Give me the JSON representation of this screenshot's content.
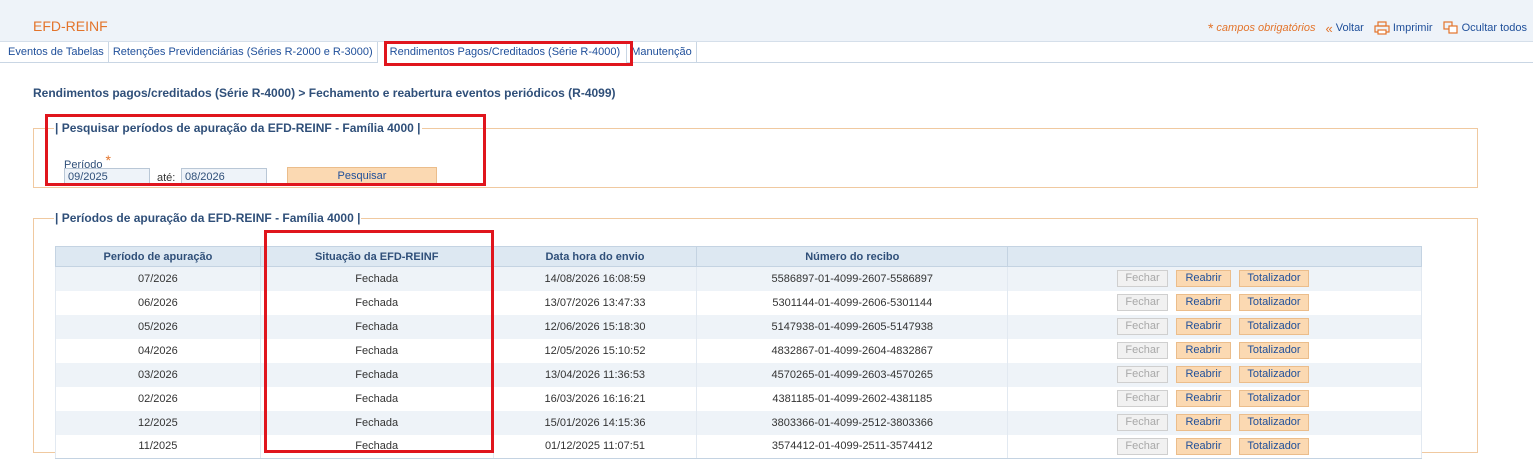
{
  "header": {
    "title": "EFD-REINF",
    "required_note": "campos obrigatórios",
    "back_label": "Voltar",
    "print_label": "Imprimir",
    "hide_all_label": "Ocultar todos"
  },
  "tabs": [
    {
      "label": "Eventos de Tabelas"
    },
    {
      "label": "Retenções Previdenciárias (Séries R-2000 e R-3000)"
    },
    {
      "label": "Rendimentos Pagos/Creditados (Série R-4000)"
    },
    {
      "label": "Manutenção"
    }
  ],
  "breadcrumb": "Rendimentos pagos/creditados (Série R-4000) > Fechamento e reabertura eventos periódicos (R-4099)",
  "search": {
    "legend": "| Pesquisar períodos de apuração da EFD-REINF - Família 4000 |",
    "periodo_label": "Período",
    "from_value": "09/2025",
    "to_label": "até:",
    "to_value": "08/2026",
    "button_label": "Pesquisar"
  },
  "results": {
    "legend": "| Períodos de apuração da EFD-REINF - Família 4000 |",
    "columns": [
      "Período de apuração",
      "Situação da EFD-REINF",
      "Data hora do envio",
      "Número do recibo",
      ""
    ],
    "action_labels": {
      "close": "Fechar",
      "reopen": "Reabrir",
      "totalizer": "Totalizador"
    },
    "rows": [
      {
        "periodo": "07/2026",
        "situacao": "Fechada",
        "data_envio": "14/08/2026 16:08:59",
        "recibo": "5586897-01-4099-2607-5586897"
      },
      {
        "periodo": "06/2026",
        "situacao": "Fechada",
        "data_envio": "13/07/2026 13:47:33",
        "recibo": "5301144-01-4099-2606-5301144"
      },
      {
        "periodo": "05/2026",
        "situacao": "Fechada",
        "data_envio": "12/06/2026 15:18:30",
        "recibo": "5147938-01-4099-2605-5147938"
      },
      {
        "periodo": "04/2026",
        "situacao": "Fechada",
        "data_envio": "12/05/2026 15:10:52",
        "recibo": "4832867-01-4099-2604-4832867"
      },
      {
        "periodo": "03/2026",
        "situacao": "Fechada",
        "data_envio": "13/04/2026 11:36:53",
        "recibo": "4570265-01-4099-2603-4570265"
      },
      {
        "periodo": "02/2026",
        "situacao": "Fechada",
        "data_envio": "16/03/2026 16:16:21",
        "recibo": "4381185-01-4099-2602-4381185"
      },
      {
        "periodo": "12/2025",
        "situacao": "Fechada",
        "data_envio": "15/01/2026 14:15:36",
        "recibo": "3803366-01-4099-2512-3803366"
      },
      {
        "periodo": "11/2025",
        "situacao": "Fechada",
        "data_envio": "01/12/2025 11:07:51",
        "recibo": "3574412-01-4099-2511-3574412"
      }
    ]
  },
  "colors": {
    "accent_orange": "#e3742b",
    "link_blue": "#1f4f9a",
    "highlight_red": "#e0151d"
  }
}
